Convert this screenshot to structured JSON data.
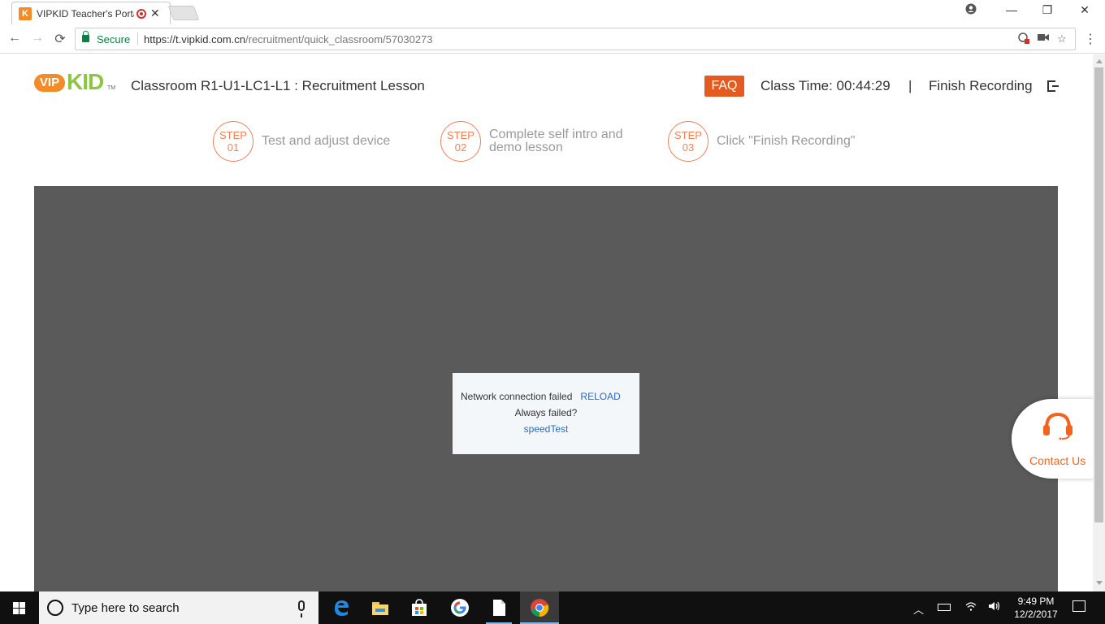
{
  "browser": {
    "tab_title": "VIPKID Teacher's Portal",
    "tab_close": "✕",
    "secure_label": "Secure",
    "url_scheme_host": "https://t.vipkid.com.cn",
    "url_path": "/recruitment/quick_classroom/57030273",
    "win_min": "—",
    "win_max": "❐",
    "win_close": "✕"
  },
  "header": {
    "logo_vip": "VIP",
    "logo_kid": "KID",
    "logo_tm": "TM",
    "classroom_title": "Classroom R1-U1-LC1-L1 : Recruitment Lesson",
    "faq_label": "FAQ",
    "class_time": "Class Time: 00:44:29",
    "separator": "|",
    "finish_label": "Finish Recording"
  },
  "steps": [
    {
      "label": "STEP",
      "number": "01",
      "text_line1": "Test and adjust device",
      "text_line2": ""
    },
    {
      "label": "STEP",
      "number": "02",
      "text_line1": "Complete self intro and",
      "text_line2": "demo lesson"
    },
    {
      "label": "STEP",
      "number": "03",
      "text_line1": "Click \"Finish Recording\"",
      "text_line2": ""
    }
  ],
  "error": {
    "message": "Network connection failed",
    "reload_label": "RELOAD",
    "always_failed": "Always failed?",
    "speedtest_label": "speedTest"
  },
  "contact": {
    "label": "Contact Us"
  },
  "taskbar": {
    "search_placeholder": "Type here to search",
    "time": "9:49 PM",
    "date": "12/2/2017"
  },
  "colors": {
    "brand_orange": "#e55a1e",
    "step_orange": "#f08058",
    "link_blue": "#2a6ab8",
    "stage_gray": "#5a5a5a",
    "logo_green": "#8cc63f"
  }
}
